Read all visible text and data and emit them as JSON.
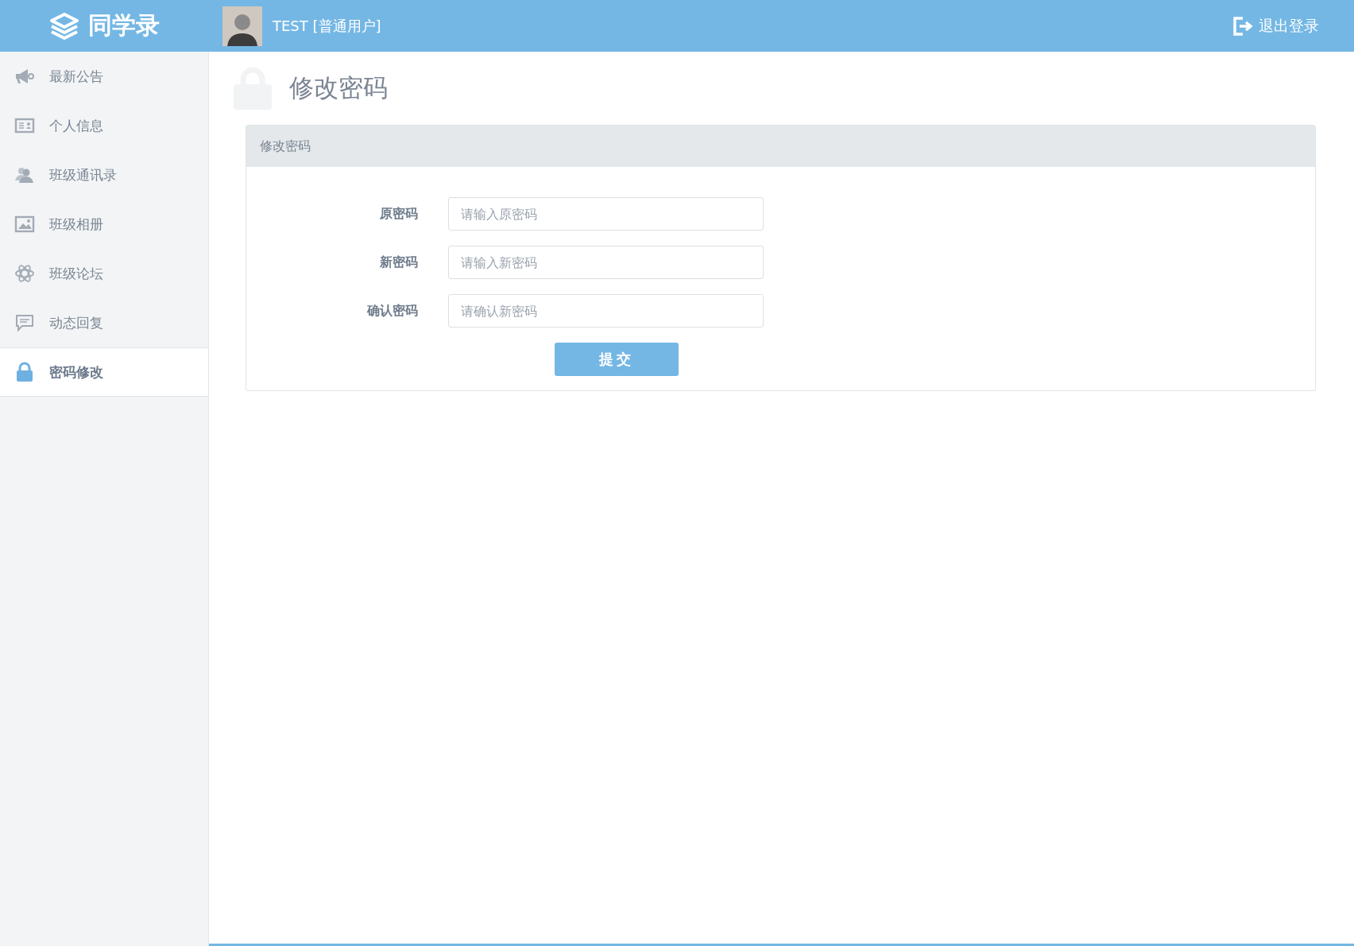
{
  "header": {
    "logo": "同学录",
    "user": "TEST [普通用户]",
    "logout": "退出登录"
  },
  "sidebar": {
    "items": [
      {
        "label": "最新公告",
        "selected": false
      },
      {
        "label": "个人信息",
        "selected": false
      },
      {
        "label": "班级通讯录",
        "selected": false
      },
      {
        "label": "班级相册",
        "selected": false
      },
      {
        "label": "班级论坛",
        "selected": false
      },
      {
        "label": "动态回复",
        "selected": false
      },
      {
        "label": "密码修改",
        "selected": true
      }
    ]
  },
  "page": {
    "title": "修改密码"
  },
  "panel": {
    "title": "修改密码",
    "fields": [
      {
        "label": "原密码",
        "placeholder": "请输入原密码"
      },
      {
        "label": "新密码",
        "placeholder": "请输入新密码"
      },
      {
        "label": "确认密码",
        "placeholder": "请确认新密码"
      }
    ],
    "submit": "提交"
  }
}
